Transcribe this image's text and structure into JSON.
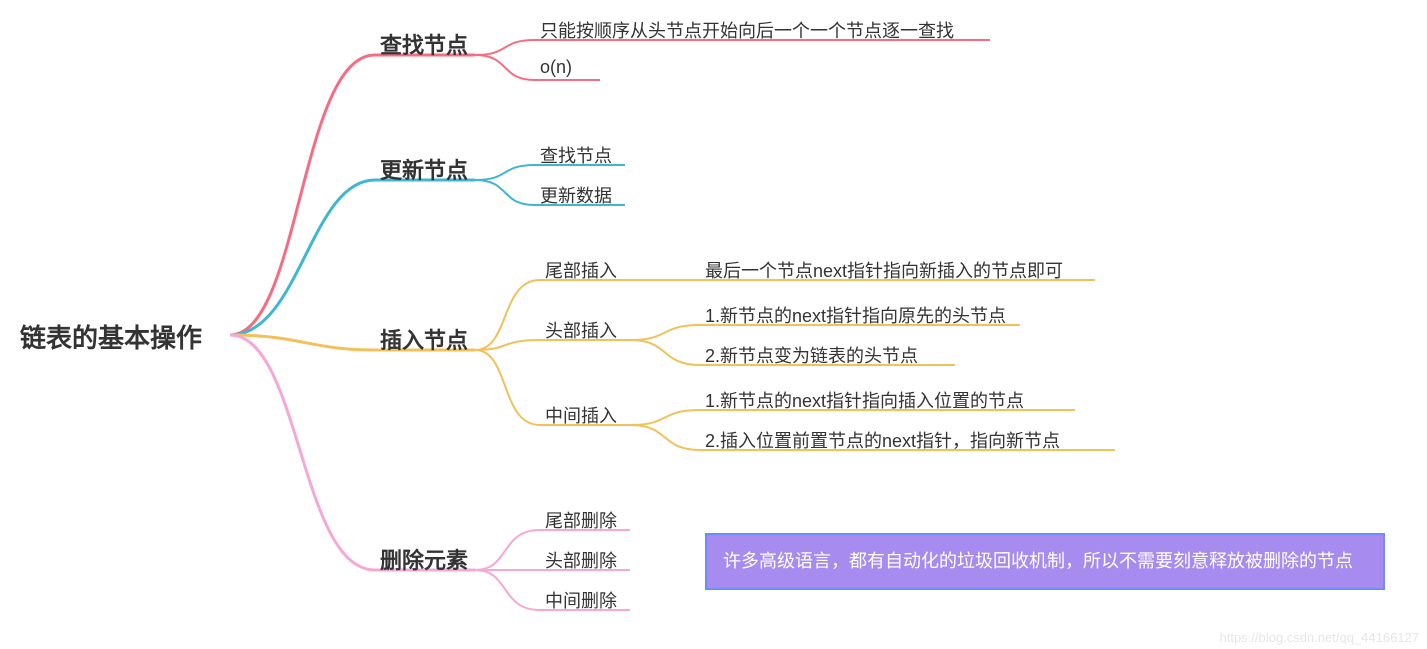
{
  "root": {
    "title": "链表的基本操作"
  },
  "colors": {
    "red": "#f76c82",
    "blue": "#3fb6d3",
    "yellow": "#f3c15b",
    "pink": "#f5a8d6"
  },
  "branches": {
    "find": {
      "title": "查找节点",
      "children": [
        {
          "text": "只能按顺序从头节点开始向后一个一个节点逐一查找"
        },
        {
          "text": "o(n)"
        }
      ]
    },
    "update": {
      "title": "更新节点",
      "children": [
        {
          "text": "查找节点"
        },
        {
          "text": "更新数据"
        }
      ]
    },
    "insert": {
      "title": "插入节点",
      "children": {
        "tail": {
          "title": "尾部插入",
          "details": [
            {
              "text": "最后一个节点next指针指向新插入的节点即可"
            }
          ]
        },
        "head": {
          "title": "头部插入",
          "details": [
            {
              "text": "1.新节点的next指针指向原先的头节点"
            },
            {
              "text": "2.新节点变为链表的头节点"
            }
          ]
        },
        "mid": {
          "title": "中间插入",
          "details": [
            {
              "text": "1.新节点的next指针指向插入位置的节点"
            },
            {
              "text": "2.插入位置前置节点的next指针，指向新节点"
            }
          ]
        }
      }
    },
    "delete": {
      "title": "删除元素",
      "children": [
        {
          "text": "尾部删除"
        },
        {
          "text": "头部删除"
        },
        {
          "text": "中间删除"
        }
      ]
    }
  },
  "note": "许多高级语言，都有自动化的垃圾回收机制，所以不需要刻意释放被删除的节点",
  "watermark": "https://blog.csdn.net/qq_44166127"
}
